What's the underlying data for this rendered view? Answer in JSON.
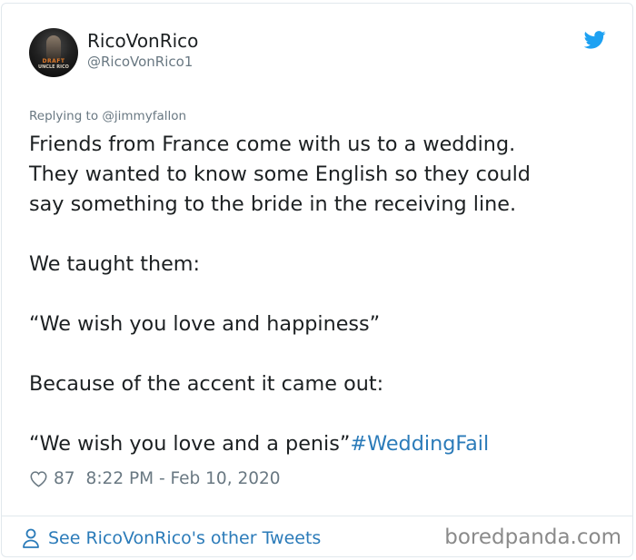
{
  "colors": {
    "link": "#2b7bb9",
    "text": "#1c2022",
    "muted": "#697882",
    "border": "#e1e8ed",
    "twitter_blue": "#1da1f2"
  },
  "author": {
    "display_name": "RicoVonRico",
    "handle": "@RicoVonRico1",
    "avatar_text": [
      "DRAFT",
      "UNCLE RICO"
    ]
  },
  "tweet": {
    "replying_to": "Replying to @jimmyfallon",
    "lines": [
      "Friends from France come with us to a wedding.",
      "They wanted to know some English so they could",
      "say something to the bride in the receiving line.",
      "",
      "We taught them:",
      "",
      "“We wish you love and happiness”",
      "",
      "Because of the accent it came out:",
      ""
    ],
    "last_line": "“We wish you love and a penis”",
    "hashtag": "#WeddingFail",
    "likes": "87",
    "timestamp": "8:22 PM - Feb 10, 2020"
  },
  "footer": {
    "see_more": "See RicoVonRico's other Tweets",
    "watermark": "boredpanda.com"
  },
  "icons": {
    "twitter_logo": "twitter-bird-icon",
    "like": "heart-icon",
    "profile": "person-icon"
  }
}
